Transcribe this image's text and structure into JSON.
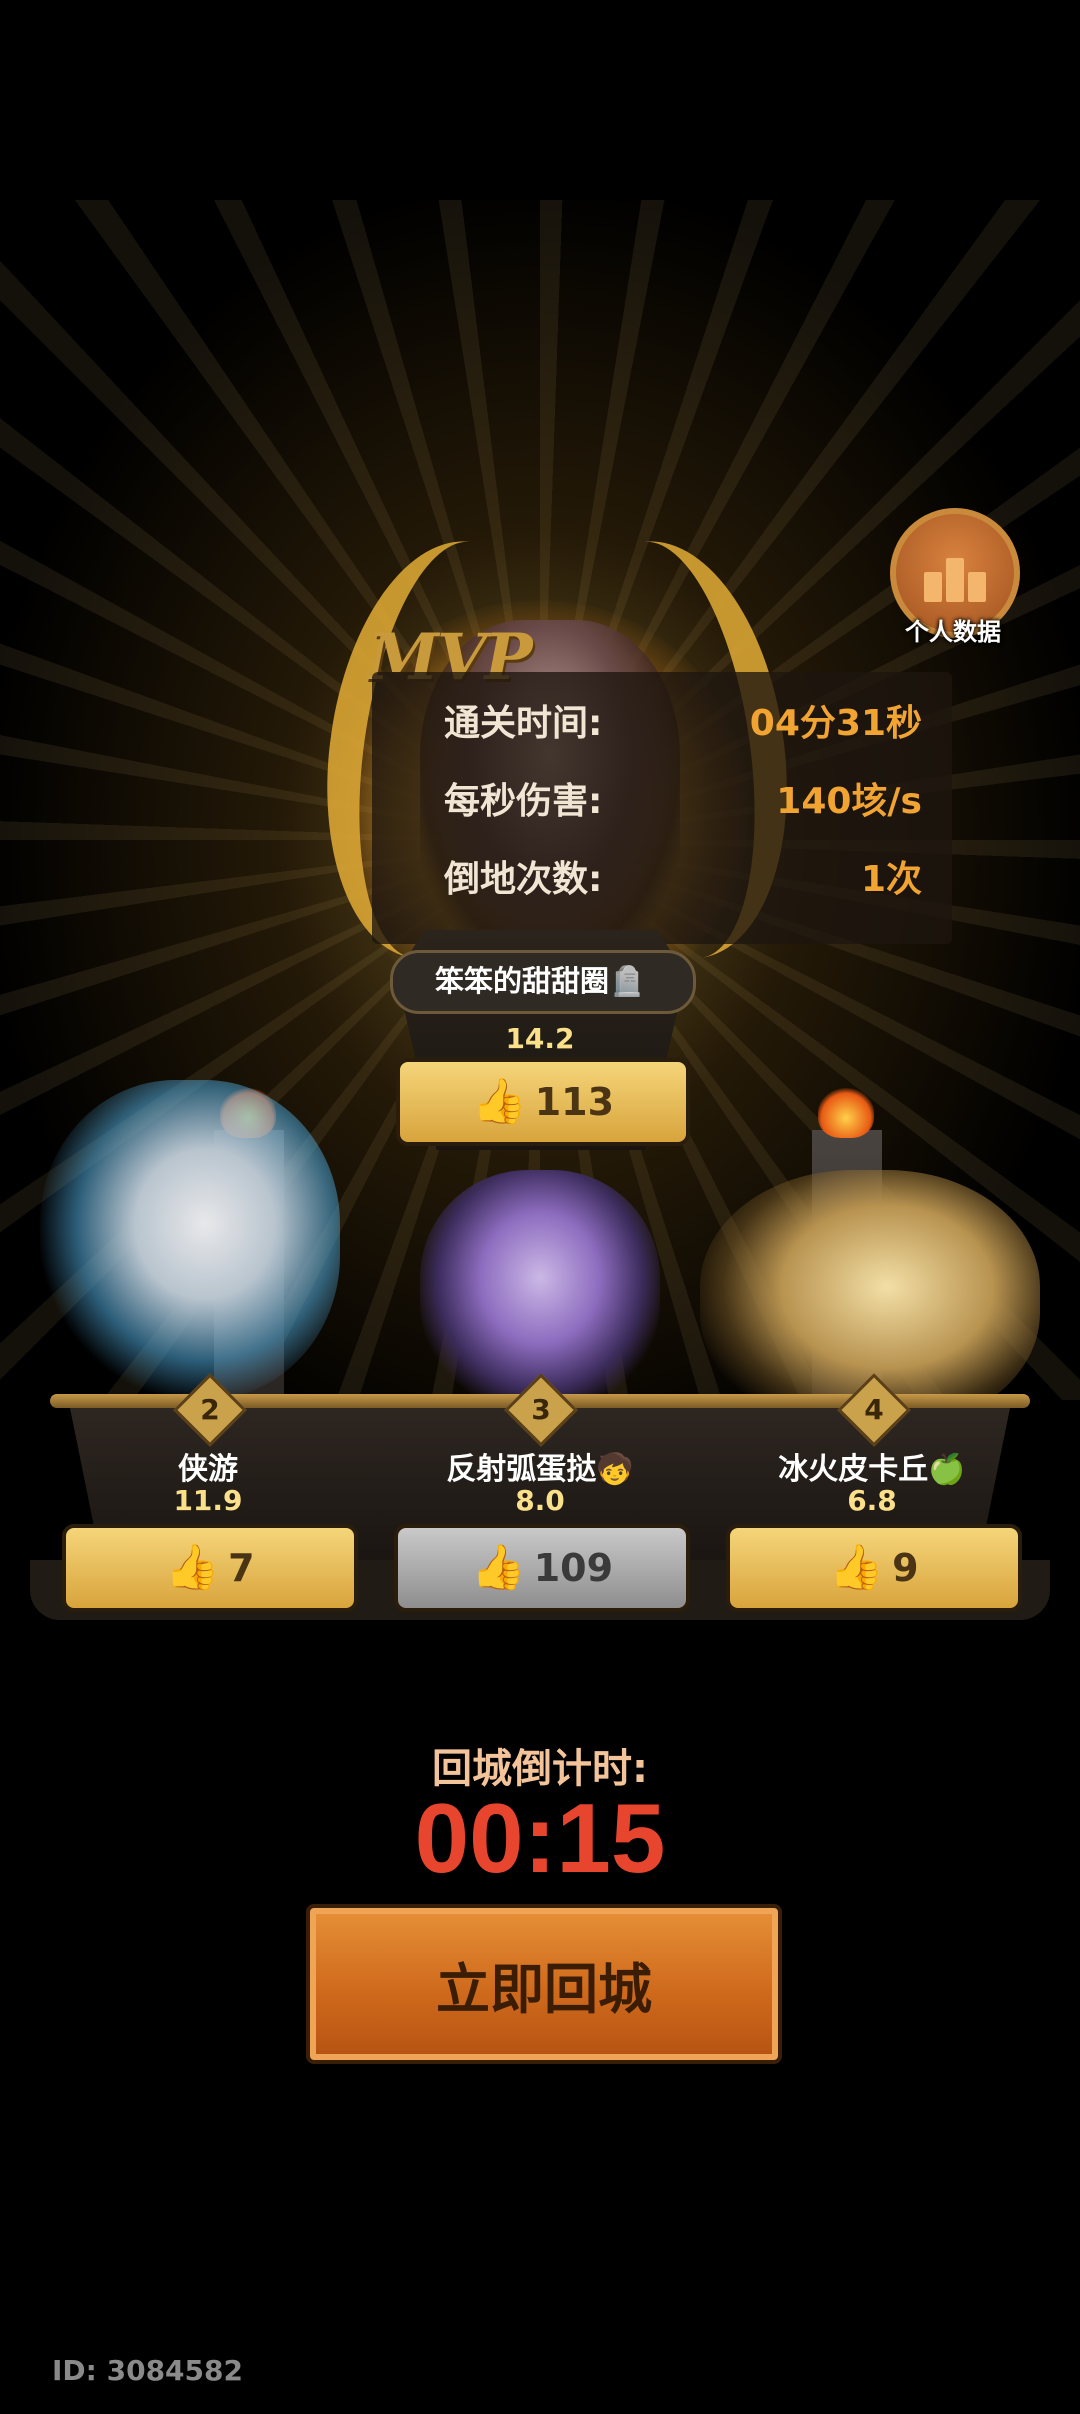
{
  "stats_button": {
    "label": "个人数据",
    "icon": "bar-chart-icon"
  },
  "mvp": {
    "badge": "MVP",
    "name": "笨笨的甜甜圈🪦",
    "score": "14.2",
    "likes": "113",
    "stats": [
      {
        "label": "通关时间:",
        "value": "04分31秒"
      },
      {
        "label": "每秒伤害:",
        "value": "140垓/s"
      },
      {
        "label": "倒地次数:",
        "value": "1次"
      }
    ]
  },
  "players": [
    {
      "rank": "2",
      "name": "侠游",
      "score": "11.9",
      "likes": "7",
      "like_style": "gold"
    },
    {
      "rank": "3",
      "name": "反射弧蛋挞🧒",
      "score": "8.0",
      "likes": "109",
      "like_style": "grey"
    },
    {
      "rank": "4",
      "name": "冰火皮卡丘🍏",
      "score": "6.8",
      "likes": "9",
      "like_style": "gold"
    }
  ],
  "countdown": {
    "label": "回城倒计时:",
    "time": "00:15"
  },
  "return_button": {
    "label": "立即回城"
  },
  "user_id": "ID: 3084582",
  "colors": {
    "gold": "#f1a431",
    "countdown_red": "#e8452e",
    "button_orange": "#cf6a1c"
  }
}
